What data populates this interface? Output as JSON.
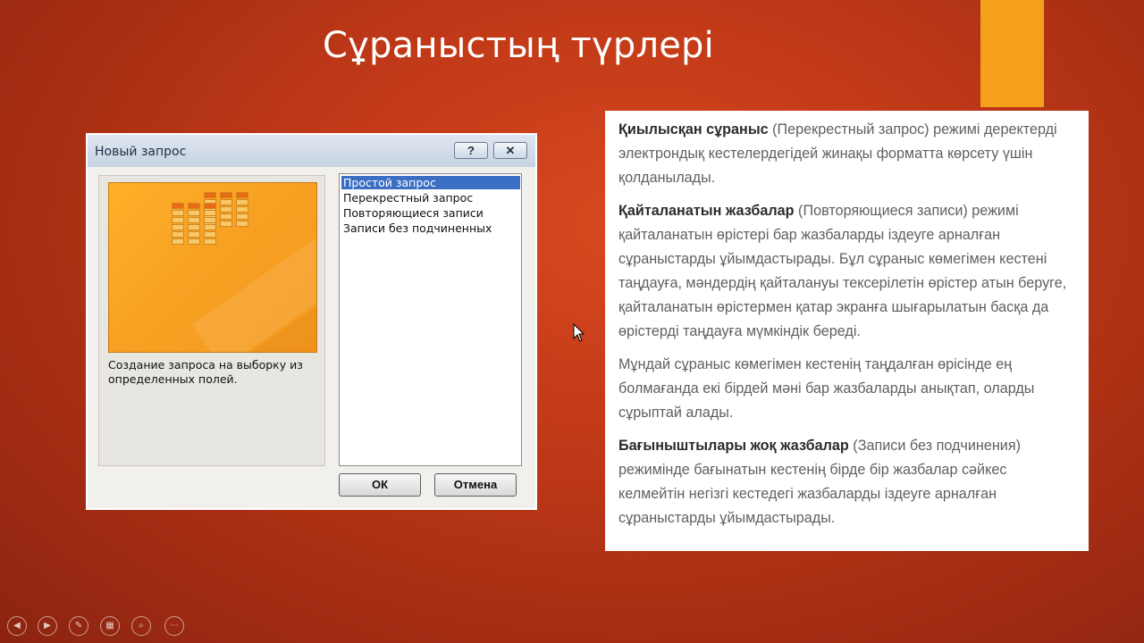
{
  "slide": {
    "title": "Сұраныстың түрлері",
    "accent_color": "#f5a01c"
  },
  "dialog": {
    "title": "Новый запрос",
    "help_label": "?",
    "close_label": "✕",
    "description": "Создание запроса на выборку из определенных полей.",
    "list_items": [
      "Простой запрос",
      "Перекрестный запрос",
      "Повторяющиеся записи",
      "Записи без подчиненных"
    ],
    "selected_item": "Простой запрос",
    "ok_label": "ОК",
    "cancel_label": "Отмена"
  },
  "text_panel": {
    "paragraphs": [
      {
        "bold": "Қиылысқан сұраныс",
        "rest": " (Перекрестный запрос) режимі деректерді электрондық кестелердегідей жинақы форматта көрсету үшін қолданылады."
      },
      {
        "bold": "Қайталанатын жазбалар",
        "rest": " (Повторяющиеся записи) режимі қайталанатын өрістері бар жазбаларды іздеуге арналған сұраныстарды ұйымдастырады. Бұл сұраныс көмегімен кестені таңдауға, мәндердің қайталануы тексерілетін өрістер атын беруге, қайталанатын өрістермен қатар экранға шығарылатын басқа да өрістерді таңдауға мүмкіндік береді."
      },
      {
        "bold": "",
        "rest": "Мұндай сұраныс көмегімен кестенің таңдалған өрісінде ең болмағанда екі бірдей мәні бар жазбаларды анықтап, оларды сұрыптай алады."
      },
      {
        "bold": "Бағыныштылары жоқ жазбалар",
        "rest": " (Записи без подчинения) режимінде бағынатын кестенің бірде бір жазбалар сәйкес келмейтін негізгі кестедегі жазбаларды іздеуге арналған сұраныстарды ұйымдастырады."
      }
    ]
  },
  "controls": {
    "icons": [
      "previous-icon",
      "next-icon",
      "pen-icon",
      "slides-icon",
      "zoom-icon",
      "more-icon"
    ]
  }
}
